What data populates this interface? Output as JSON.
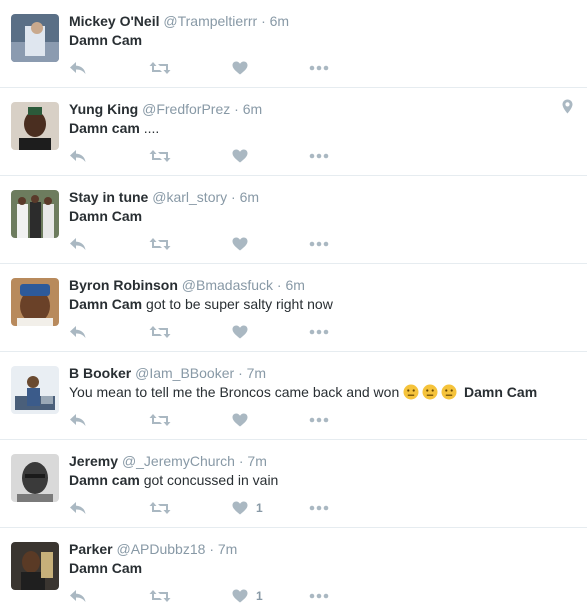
{
  "colors": {
    "name": "#292f33",
    "meta": "#8899a6",
    "action_icon": "#aab8c2",
    "divider": "#e6ecf0"
  },
  "tweets": [
    {
      "name": "Mickey O'Neil",
      "handle": "@Trampeltierrr",
      "dot": "·",
      "time": "6m",
      "text_bold": "Damn Cam",
      "text_rest": "",
      "likes": "",
      "geo": false
    },
    {
      "name": "Yung King",
      "handle": "@FredforPrez",
      "dot": "·",
      "time": "6m",
      "text_bold": "Damn cam",
      "text_rest": " ....",
      "likes": "",
      "geo": true
    },
    {
      "name": "Stay in tune",
      "handle": "@karl_story",
      "dot": "·",
      "time": "6m",
      "text_bold": "Damn Cam",
      "text_rest": "",
      "likes": "",
      "geo": false
    },
    {
      "name": "Byron Robinson",
      "handle": "@Bmadasfuck",
      "dot": "·",
      "time": "6m",
      "text_bold": "Damn Cam",
      "text_rest": " got to be super salty right now",
      "likes": "",
      "geo": false
    },
    {
      "name": "B Booker",
      "handle": "@Iam_BBooker",
      "dot": "·",
      "time": "7m",
      "text_pre": "You mean to tell me the Broncos came back and won ",
      "emoji": [
        "neutral-face-emoji",
        "neutral-face-emoji",
        "neutral-face-emoji"
      ],
      "text_bold": "Damn Cam",
      "likes": "",
      "geo": false
    },
    {
      "name": "Jeremy",
      "handle": "@_JeremyChurch",
      "dot": "·",
      "time": "7m",
      "text_bold": "Damn cam",
      "text_rest": " got concussed in vain",
      "likes": "1",
      "geo": false
    },
    {
      "name": "Parker",
      "handle": "@APDubbz18",
      "dot": "·",
      "time": "7m",
      "text_bold": "Damn Cam",
      "text_rest": "",
      "likes": "1",
      "geo": false
    }
  ]
}
